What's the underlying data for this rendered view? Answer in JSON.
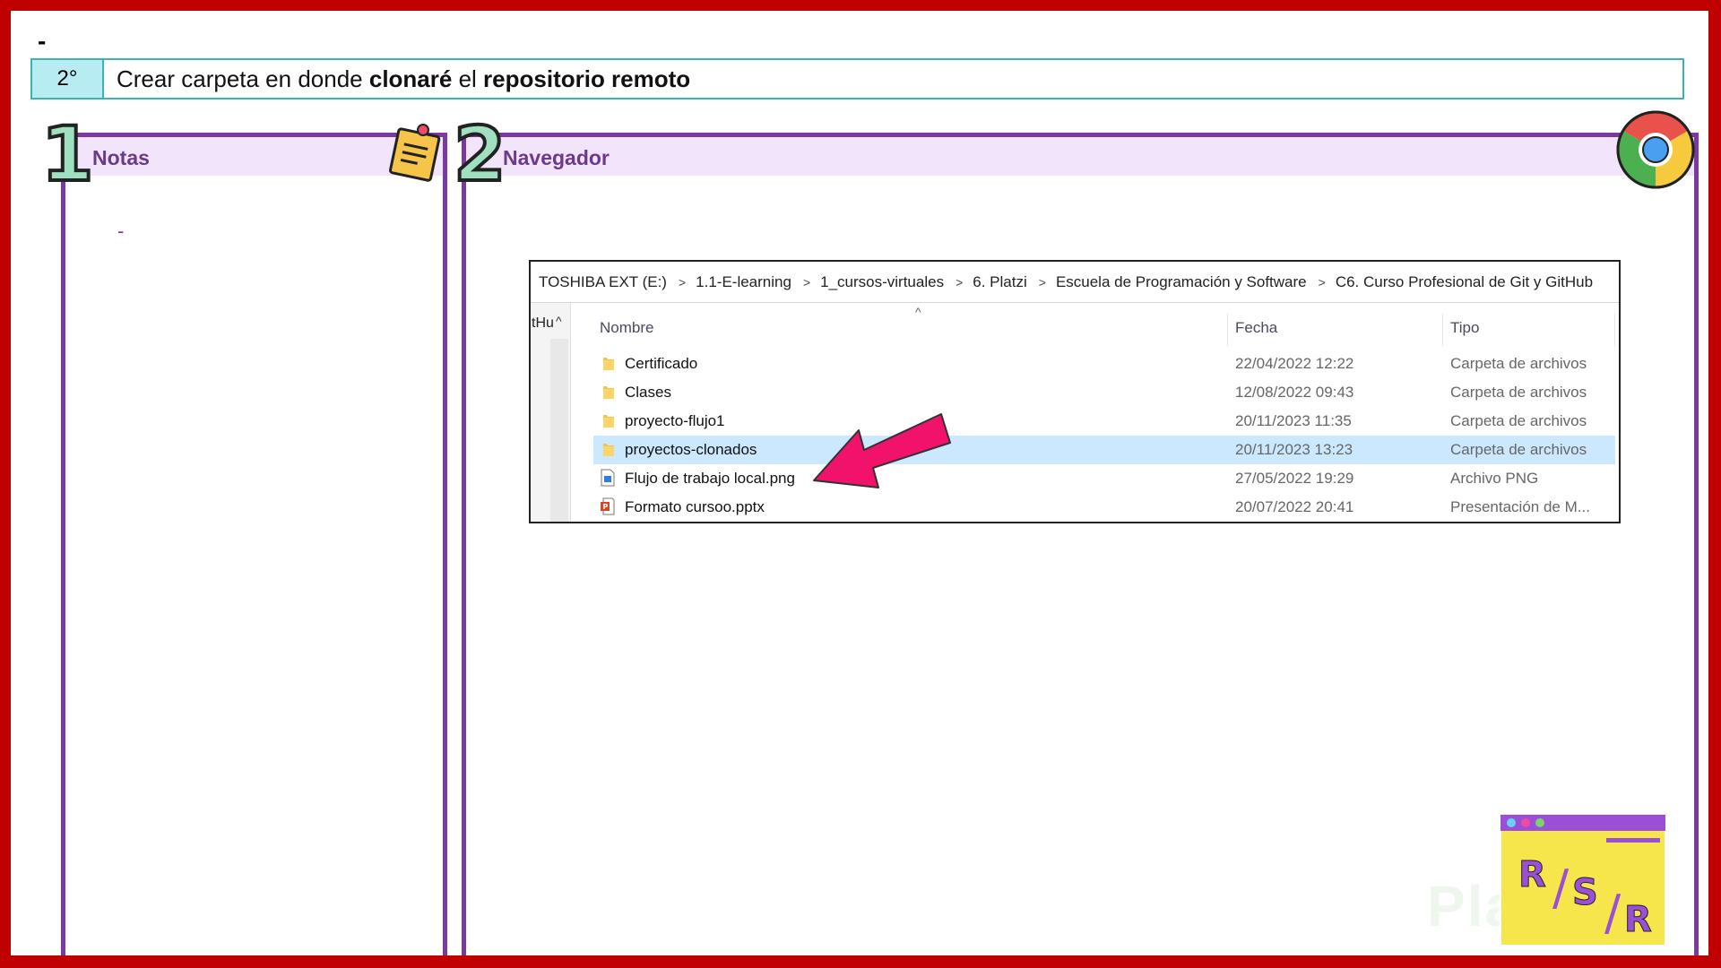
{
  "slide": {
    "top_dash": "-",
    "step_number": "2°",
    "step_text_parts": [
      "Crear carpeta en donde ",
      "clonaré",
      " el ",
      "repositorio remoto"
    ]
  },
  "notes_panel": {
    "number": "1",
    "title": "Notas",
    "dash": "-"
  },
  "browser_panel": {
    "number": "2",
    "title": "Navegador"
  },
  "explorer": {
    "breadcrumb": [
      "TOSHIBA EXT (E:)",
      "1.1-E-learning",
      "1_cursos-virtuales",
      "6. Platzi",
      "Escuela de Programación y Software",
      "C6. Curso Profesional de Git y GitHub"
    ],
    "left_pane_text": "tHu",
    "columns": {
      "name": "Nombre",
      "date": "Fecha",
      "type": "Tipo"
    },
    "rows": [
      {
        "name": "Certificado",
        "date": "22/04/2022 12:22",
        "type": "Carpeta de archivos",
        "icon": "folder-icon"
      },
      {
        "name": "Clases",
        "date": "12/08/2022 09:43",
        "type": "Carpeta de archivos",
        "icon": "folder-icon"
      },
      {
        "name": "proyecto-flujo1",
        "date": "20/11/2023 11:35",
        "type": "Carpeta de archivos",
        "icon": "folder-icon"
      },
      {
        "name": "proyectos-clonados",
        "date": "20/11/2023 13:23",
        "type": "Carpeta de archivos",
        "icon": "folder-icon",
        "selected": true
      },
      {
        "name": "Flujo de trabajo local.png",
        "date": "27/05/2022 19:29",
        "type": "Archivo PNG",
        "icon": "png-file-icon"
      },
      {
        "name": "Formato cursoo.pptx",
        "date": "20/07/2022 20:41",
        "type": "Presentación de M...",
        "icon": "pptx-file-icon"
      }
    ]
  },
  "logo": {
    "letters": [
      "R",
      "/",
      "S",
      "/",
      "R"
    ]
  },
  "watermark": "Platzi",
  "colors": {
    "frame": "#c00000",
    "panel_border": "#7a3aa0",
    "step_border": "#3ab3b3",
    "arrow": "#f0126b",
    "selected_row": "#cce8ff"
  }
}
